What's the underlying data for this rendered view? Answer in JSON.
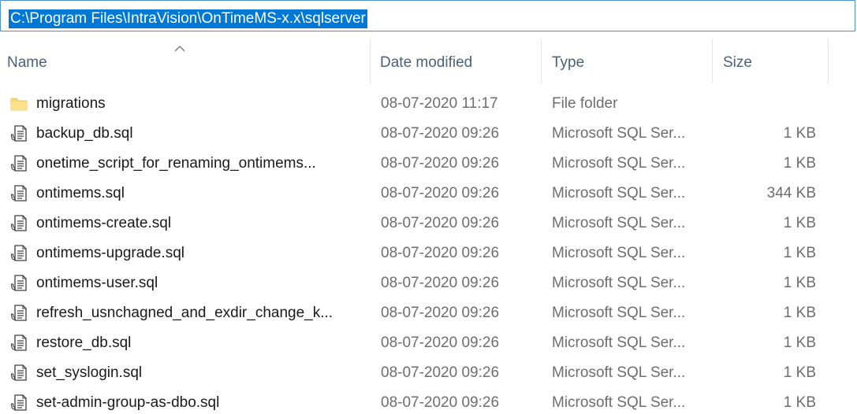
{
  "address_bar": {
    "path": "C:\\Program Files\\IntraVision\\OnTimeMS-x.x\\sqlserver"
  },
  "columns": {
    "name": "Name",
    "date_modified": "Date modified",
    "type": "Type",
    "size": "Size"
  },
  "sort": {
    "column": "name",
    "direction": "ascending",
    "icon": "sort-up-caret-icon"
  },
  "icons": {
    "folder": "folder-icon",
    "sql_file": "sql-file-icon"
  },
  "files": [
    {
      "name": "migrations",
      "date": "08-07-2020 11:17",
      "type": "File folder",
      "size": "",
      "kind": "folder"
    },
    {
      "name": "backup_db.sql",
      "date": "08-07-2020 09:26",
      "type": "Microsoft SQL Ser...",
      "size": "1 KB",
      "kind": "file"
    },
    {
      "name": "onetime_script_for_renaming_ontimems...",
      "date": "08-07-2020 09:26",
      "type": "Microsoft SQL Ser...",
      "size": "1 KB",
      "kind": "file"
    },
    {
      "name": "ontimems.sql",
      "date": "08-07-2020 09:26",
      "type": "Microsoft SQL Ser...",
      "size": "344 KB",
      "kind": "file"
    },
    {
      "name": "ontimems-create.sql",
      "date": "08-07-2020 09:26",
      "type": "Microsoft SQL Ser...",
      "size": "1 KB",
      "kind": "file"
    },
    {
      "name": "ontimems-upgrade.sql",
      "date": "08-07-2020 09:26",
      "type": "Microsoft SQL Ser...",
      "size": "1 KB",
      "kind": "file"
    },
    {
      "name": "ontimems-user.sql",
      "date": "08-07-2020 09:26",
      "type": "Microsoft SQL Ser...",
      "size": "1 KB",
      "kind": "file"
    },
    {
      "name": "refresh_usnchagned_and_exdir_change_k...",
      "date": "08-07-2020 09:26",
      "type": "Microsoft SQL Ser...",
      "size": "1 KB",
      "kind": "file"
    },
    {
      "name": "restore_db.sql",
      "date": "08-07-2020 09:26",
      "type": "Microsoft SQL Ser...",
      "size": "1 KB",
      "kind": "file"
    },
    {
      "name": "set_syslogin.sql",
      "date": "08-07-2020 09:26",
      "type": "Microsoft SQL Ser...",
      "size": "1 KB",
      "kind": "file"
    },
    {
      "name": "set-admin-group-as-dbo.sql",
      "date": "08-07-2020 09:26",
      "type": "Microsoft SQL Ser...",
      "size": "1 KB",
      "kind": "file"
    }
  ]
}
